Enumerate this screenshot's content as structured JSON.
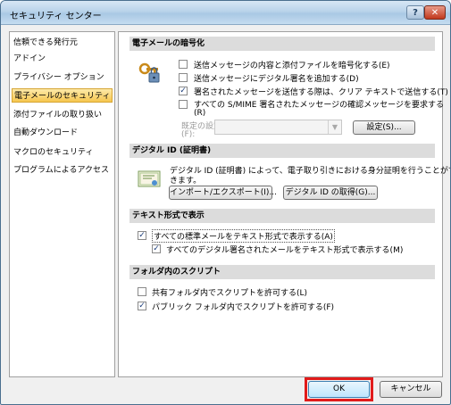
{
  "window": {
    "title": "セキュリティ センター",
    "help_label": "?",
    "close_label": "✕"
  },
  "sidebar": {
    "items": [
      {
        "label": "信頼できる発行元"
      },
      {
        "label": "アドイン"
      },
      {
        "label": "プライバシー オプション"
      },
      {
        "label": "電子メールのセキュリティ",
        "selected": true
      },
      {
        "label": "添付ファイルの取り扱い"
      },
      {
        "label": "自動ダウンロード"
      },
      {
        "label": "マクロのセキュリティ"
      },
      {
        "label": "プログラムによるアクセス"
      }
    ]
  },
  "email_encryption": {
    "header": "電子メールの暗号化",
    "options": [
      {
        "label": "送信メッセージの内容と添付ファイルを暗号化する(E)",
        "checked": false
      },
      {
        "label": "送信メッセージにデジタル署名を追加する(D)",
        "checked": false
      },
      {
        "label": "署名されたメッセージを送信する際は、クリア テキストで送信する(T)",
        "checked": true
      },
      {
        "label": "すべての S/MIME 署名されたメッセージの確認メッセージを要求する",
        "label2": "(R)",
        "checked": false
      }
    ],
    "default_setting_label": "既定の設定",
    "default_setting_label2": "(F):",
    "settings_button": "設定(S)..."
  },
  "digital_id": {
    "header": "デジタル ID (証明書)",
    "description_line1": "デジタル ID (証明書) によって、電子取り引きにおける身分証明を行うことがで",
    "description_line2": "きます。",
    "import_export_button": "インポート/エクスポート(I)...",
    "get_id_button": "デジタル ID の取得(G)..."
  },
  "text_format": {
    "header": "テキスト形式で表示",
    "options": [
      {
        "label": "すべての標準メールをテキスト形式で表示する(A)",
        "checked": true
      },
      {
        "label": "すべてのデジタル署名されたメールをテキスト形式で表示する(M)",
        "checked": true
      }
    ]
  },
  "folder_script": {
    "header": "フォルダ内のスクリプト",
    "options": [
      {
        "label": "共有フォルダ内でスクリプトを許可する(L)",
        "checked": false
      },
      {
        "label": "パブリック フォルダ内でスクリプトを許可する(F)",
        "checked": true
      }
    ]
  },
  "footer": {
    "ok_label": "OK",
    "cancel_label": "キャンセル"
  },
  "colors": {
    "highlight_border": "#e11b1b",
    "selected_item": "#f6c64f",
    "check_mark": "#1a3c7a"
  }
}
